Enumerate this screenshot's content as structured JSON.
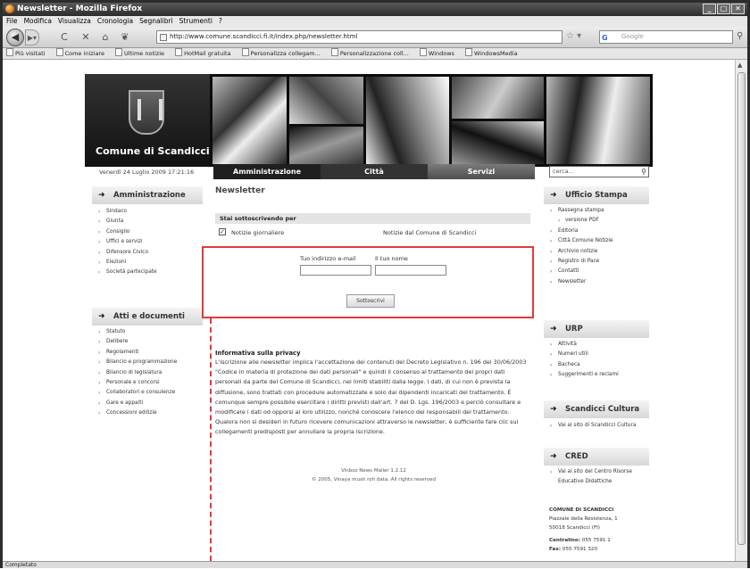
{
  "window": {
    "title": "Newsletter - Mozilla Firefox",
    "min": "_",
    "max": "□",
    "close": "✕"
  },
  "menu": [
    "File",
    "Modifica",
    "Visualizza",
    "Cronologia",
    "Segnalibri",
    "Strumenti",
    "?"
  ],
  "nav": {
    "url": "http://www.comune.scandicci.fi.it/index.php/newsletter.html",
    "search_placeholder": "Google",
    "search_engine": "G"
  },
  "bookmarks": [
    "Più visitati",
    "Come iniziare",
    "Ultime notizie",
    "HotMail gratuita",
    "Personalizza collegam...",
    "Personalizzazione coll...",
    "Windows",
    "WindowsMedia"
  ],
  "status": "Completato",
  "site": {
    "logo": "Comune di Scandicci",
    "date": "Venerdì 24 Luglio 2009 17:21:16",
    "tabs": [
      "Amministrazione",
      "Città",
      "Servizi"
    ],
    "search_placeholder": "cerca..."
  },
  "left_boxes": [
    {
      "title": "Amministrazione",
      "items": [
        "Sindaco",
        "Giunta",
        "Consiglio",
        "Uffici e servizi",
        "Difensore Civico",
        "Elezioni",
        "Società partecipate"
      ]
    },
    {
      "title": "Atti e documenti",
      "items": [
        "Statuto",
        "Delibere",
        "Regolamenti",
        "Bilancio e programmazione",
        "Bilancio di legislatura",
        "Personale e concorsi",
        "Collaboratori e consulenze",
        "Gare e appalti",
        "Concessioni edilizie"
      ]
    }
  ],
  "right_boxes": [
    {
      "title": "Ufficio Stampa",
      "items": [
        {
          "t": "Rassegna stampa",
          "sub": false
        },
        {
          "t": "versione PDF",
          "sub": true
        },
        {
          "t": "Editoria",
          "sub": false
        },
        {
          "t": "Città Comune Notizie",
          "sub": false
        },
        {
          "t": "Archivio notizie",
          "sub": false
        },
        {
          "t": "Registro di Pace",
          "sub": false
        },
        {
          "t": "Contatti",
          "sub": false
        },
        {
          "t": "Newsletter",
          "sub": false
        }
      ]
    },
    {
      "title": "URP",
      "items": [
        {
          "t": "Attività",
          "sub": false
        },
        {
          "t": "Numeri utili",
          "sub": false
        },
        {
          "t": "Bacheca",
          "sub": false
        },
        {
          "t": "Suggerimenti e reclami",
          "sub": false
        }
      ]
    },
    {
      "title": "Scandicci Cultura",
      "items": [
        {
          "t": "Vai al sito di Scandicci Cultura",
          "sub": false
        }
      ]
    },
    {
      "title": "CRED",
      "items": [
        {
          "t": "Vai al sito del Centro Risorse",
          "sub": false
        },
        {
          "t": "Educative Didattiche",
          "sub": false,
          "cont": true
        }
      ]
    }
  ],
  "main": {
    "title": "Newsletter",
    "subscribing": "Stai sottoscrivendo per",
    "list_name": "Notizie giornaliere",
    "list_desc": "Notizie dal Comune di Scandicci",
    "email_label": "Tuo indirizzo e-mail",
    "name_label": "Il tuo nome",
    "submit": "Sottoscrivi",
    "privacy_title": "Informativa sulla privacy",
    "privacy_text": "L'iscrizione alle newsletter implica l'accettazione dei contenuti del Decreto Legislativo n. 196 del 30/06/2003 \"Codice in materia di protezione dei dati personali\" e quindi il consenso al trattamento dei propri dati personali da parte del Comune di Scandicci, nei limiti stabiliti dalla legge. I dati, di cui non è prevista la diffusione, sono trattati con procedure automatizzate e solo dai dipendenti incaricati del trattamento. È comunque sempre possibile esercitare i diritti previsti dall'art. 7 del D. Lgs. 196/2003 e perciò consultare e modificare i dati od opporsi al loro utilizzo, nonché conoscere l'elenco dei responsabili del trattamento. Qualora non si desideri in futuro ricevere comunicazioni attraverso le newsletter, è sufficiente fare clic sui collegamenti predisposti per annullare la propria iscrizione.",
    "footer1": "Vinboz News Mailer 1.2.12",
    "footer2": "© 2005, Vinaya mush roh data. All rights reserved"
  },
  "contact": {
    "name": "COMUNE DI SCANDICCI",
    "addr1": "Piazzale della Resistenza, 1",
    "addr2": "50018 Scandicci (FI)",
    "tel_label": "Centralino:",
    "tel": "055 7591 1",
    "fax_label": "Fax:",
    "fax": "055 7591 320"
  }
}
